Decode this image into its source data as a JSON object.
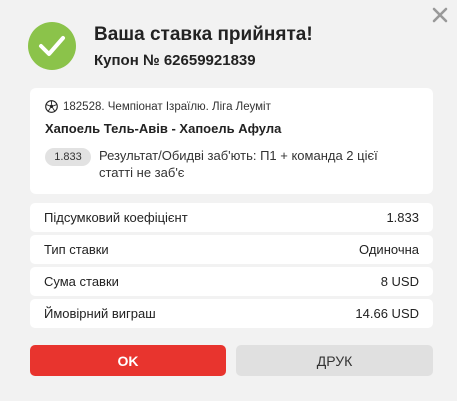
{
  "header": {
    "title": "Ваша ставка прийнята!",
    "coupon": "Купон № 62659921839"
  },
  "event": {
    "league": "182528. Чемпіонат Ізраїлю. Ліга Леуміт",
    "match": "Хапоель Тель-Авів - Хапоель Афула",
    "odds": "1.833",
    "outcome": "Результат/Обидві заб'ють: П1 + команда 2 цієї статті не заб'є"
  },
  "summary": [
    {
      "label": "Підсумковий коефіцієнт",
      "value": "1.833"
    },
    {
      "label": "Тип ставки",
      "value": "Одиночна"
    },
    {
      "label": "Сума ставки",
      "value": "8 USD"
    },
    {
      "label": "Ймовірний виграш",
      "value": "14.66 USD"
    }
  ],
  "buttons": {
    "ok": "OK",
    "print": "ДРУК"
  },
  "colors": {
    "success": "#8bc34a",
    "primary": "#e8342e",
    "secondary": "#e0e0e0"
  },
  "icons": {
    "close": "close-icon",
    "success": "checkmark-icon",
    "sport": "soccer-ball-icon"
  }
}
